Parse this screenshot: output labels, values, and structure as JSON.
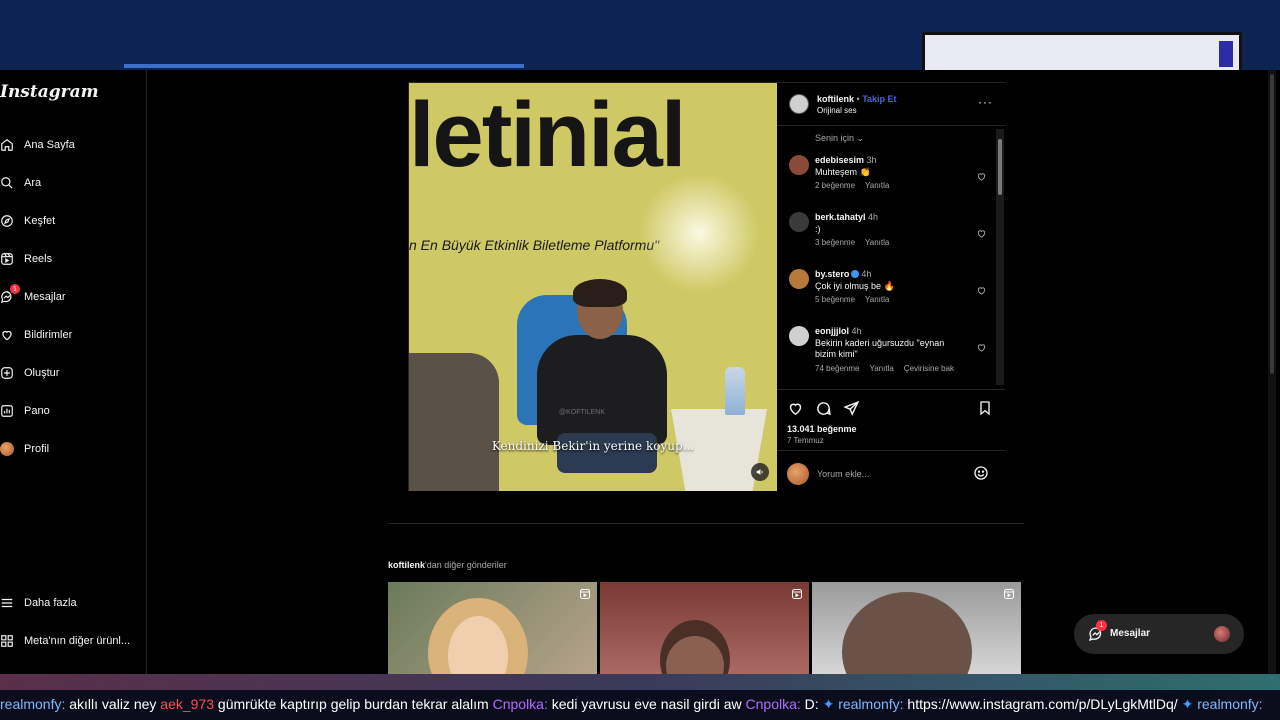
{
  "app": {
    "logo": "Instagram"
  },
  "sidebar": {
    "items": [
      {
        "label": "Ana Sayfa"
      },
      {
        "label": "Ara"
      },
      {
        "label": "Keşfet"
      },
      {
        "label": "Reels"
      },
      {
        "label": "Mesajlar",
        "badge": "1"
      },
      {
        "label": "Bildirimler"
      },
      {
        "label": "Oluştur"
      },
      {
        "label": "Pano"
      },
      {
        "label": "Profil"
      }
    ],
    "more": "Daha fazla",
    "meta": "Meta'nın diğer ürünl..."
  },
  "post": {
    "media": {
      "banner": "letinial",
      "tagline": "n En Büyük Etkinlik Biletleme Platformu\"",
      "caption": "Kendinizi Bekir'in yerine koyup...",
      "watermark": "@KOFTILENK"
    },
    "header": {
      "username": "koftilenk",
      "separator": "•",
      "follow": "Takip Et",
      "audio": "Orijinal ses",
      "more": "···"
    },
    "sort_label": "Senin için",
    "comments": [
      {
        "user": "edebisesim",
        "time": "3h",
        "text": "Muhteşem 👏",
        "likes": "2 beğenme",
        "reply": "Yanıtla",
        "verified": false,
        "avatar_color": "#8a4a3a"
      },
      {
        "user": "berk.tahatyl",
        "time": "4h",
        "text": ":)",
        "likes": "3 beğenme",
        "reply": "Yanıtla",
        "verified": false,
        "avatar_color": "#3a3a3a"
      },
      {
        "user": "by.stero",
        "time": "4h",
        "text": "Çok iyi olmuş be 🔥",
        "likes": "5 beğenme",
        "reply": "Yanıtla",
        "verified": true,
        "avatar_color": "#b87a3a"
      },
      {
        "user": "eonjjjlol",
        "time": "4h",
        "text": "Bekirin kaderi uğursuzdu \"eynan bizim kimi\"",
        "likes": "74 beğenme",
        "reply": "Yanıtla",
        "translate": "Çevirisine bak",
        "verified": false,
        "avatar_color": "#d0d0d0"
      }
    ],
    "likes": "13.041 beğenme",
    "date": "7 Temmuz",
    "comment_placeholder": "Yorum ekle..."
  },
  "more_posts": {
    "user": "koftilenk",
    "suffix": "'dan diğer gönderiler"
  },
  "messages_pill": {
    "label": "Mesajlar",
    "badge": "1"
  },
  "ticker": {
    "segments": [
      {
        "user": "realmonfy:",
        "text": " akıllı valiz ney "
      },
      {
        "user": "aek_973",
        "text": " gümrükte kaptırıp gelip burdan tekrar alalım "
      },
      {
        "user": "Cnpolka:",
        "text": " kedi yavrusu eve nasil girdi aw "
      },
      {
        "user": "Cnpolka:",
        "text": " D: "
      },
      {
        "user": "realmonfy:",
        "text": " https://www.instagram.com/p/DLyLgkMtlDq/ "
      },
      {
        "user": "realmonfy:",
        "text": ""
      }
    ]
  },
  "colors": {
    "accent": "#4a5df9",
    "badge": "#ff3040",
    "background": "#000000"
  }
}
